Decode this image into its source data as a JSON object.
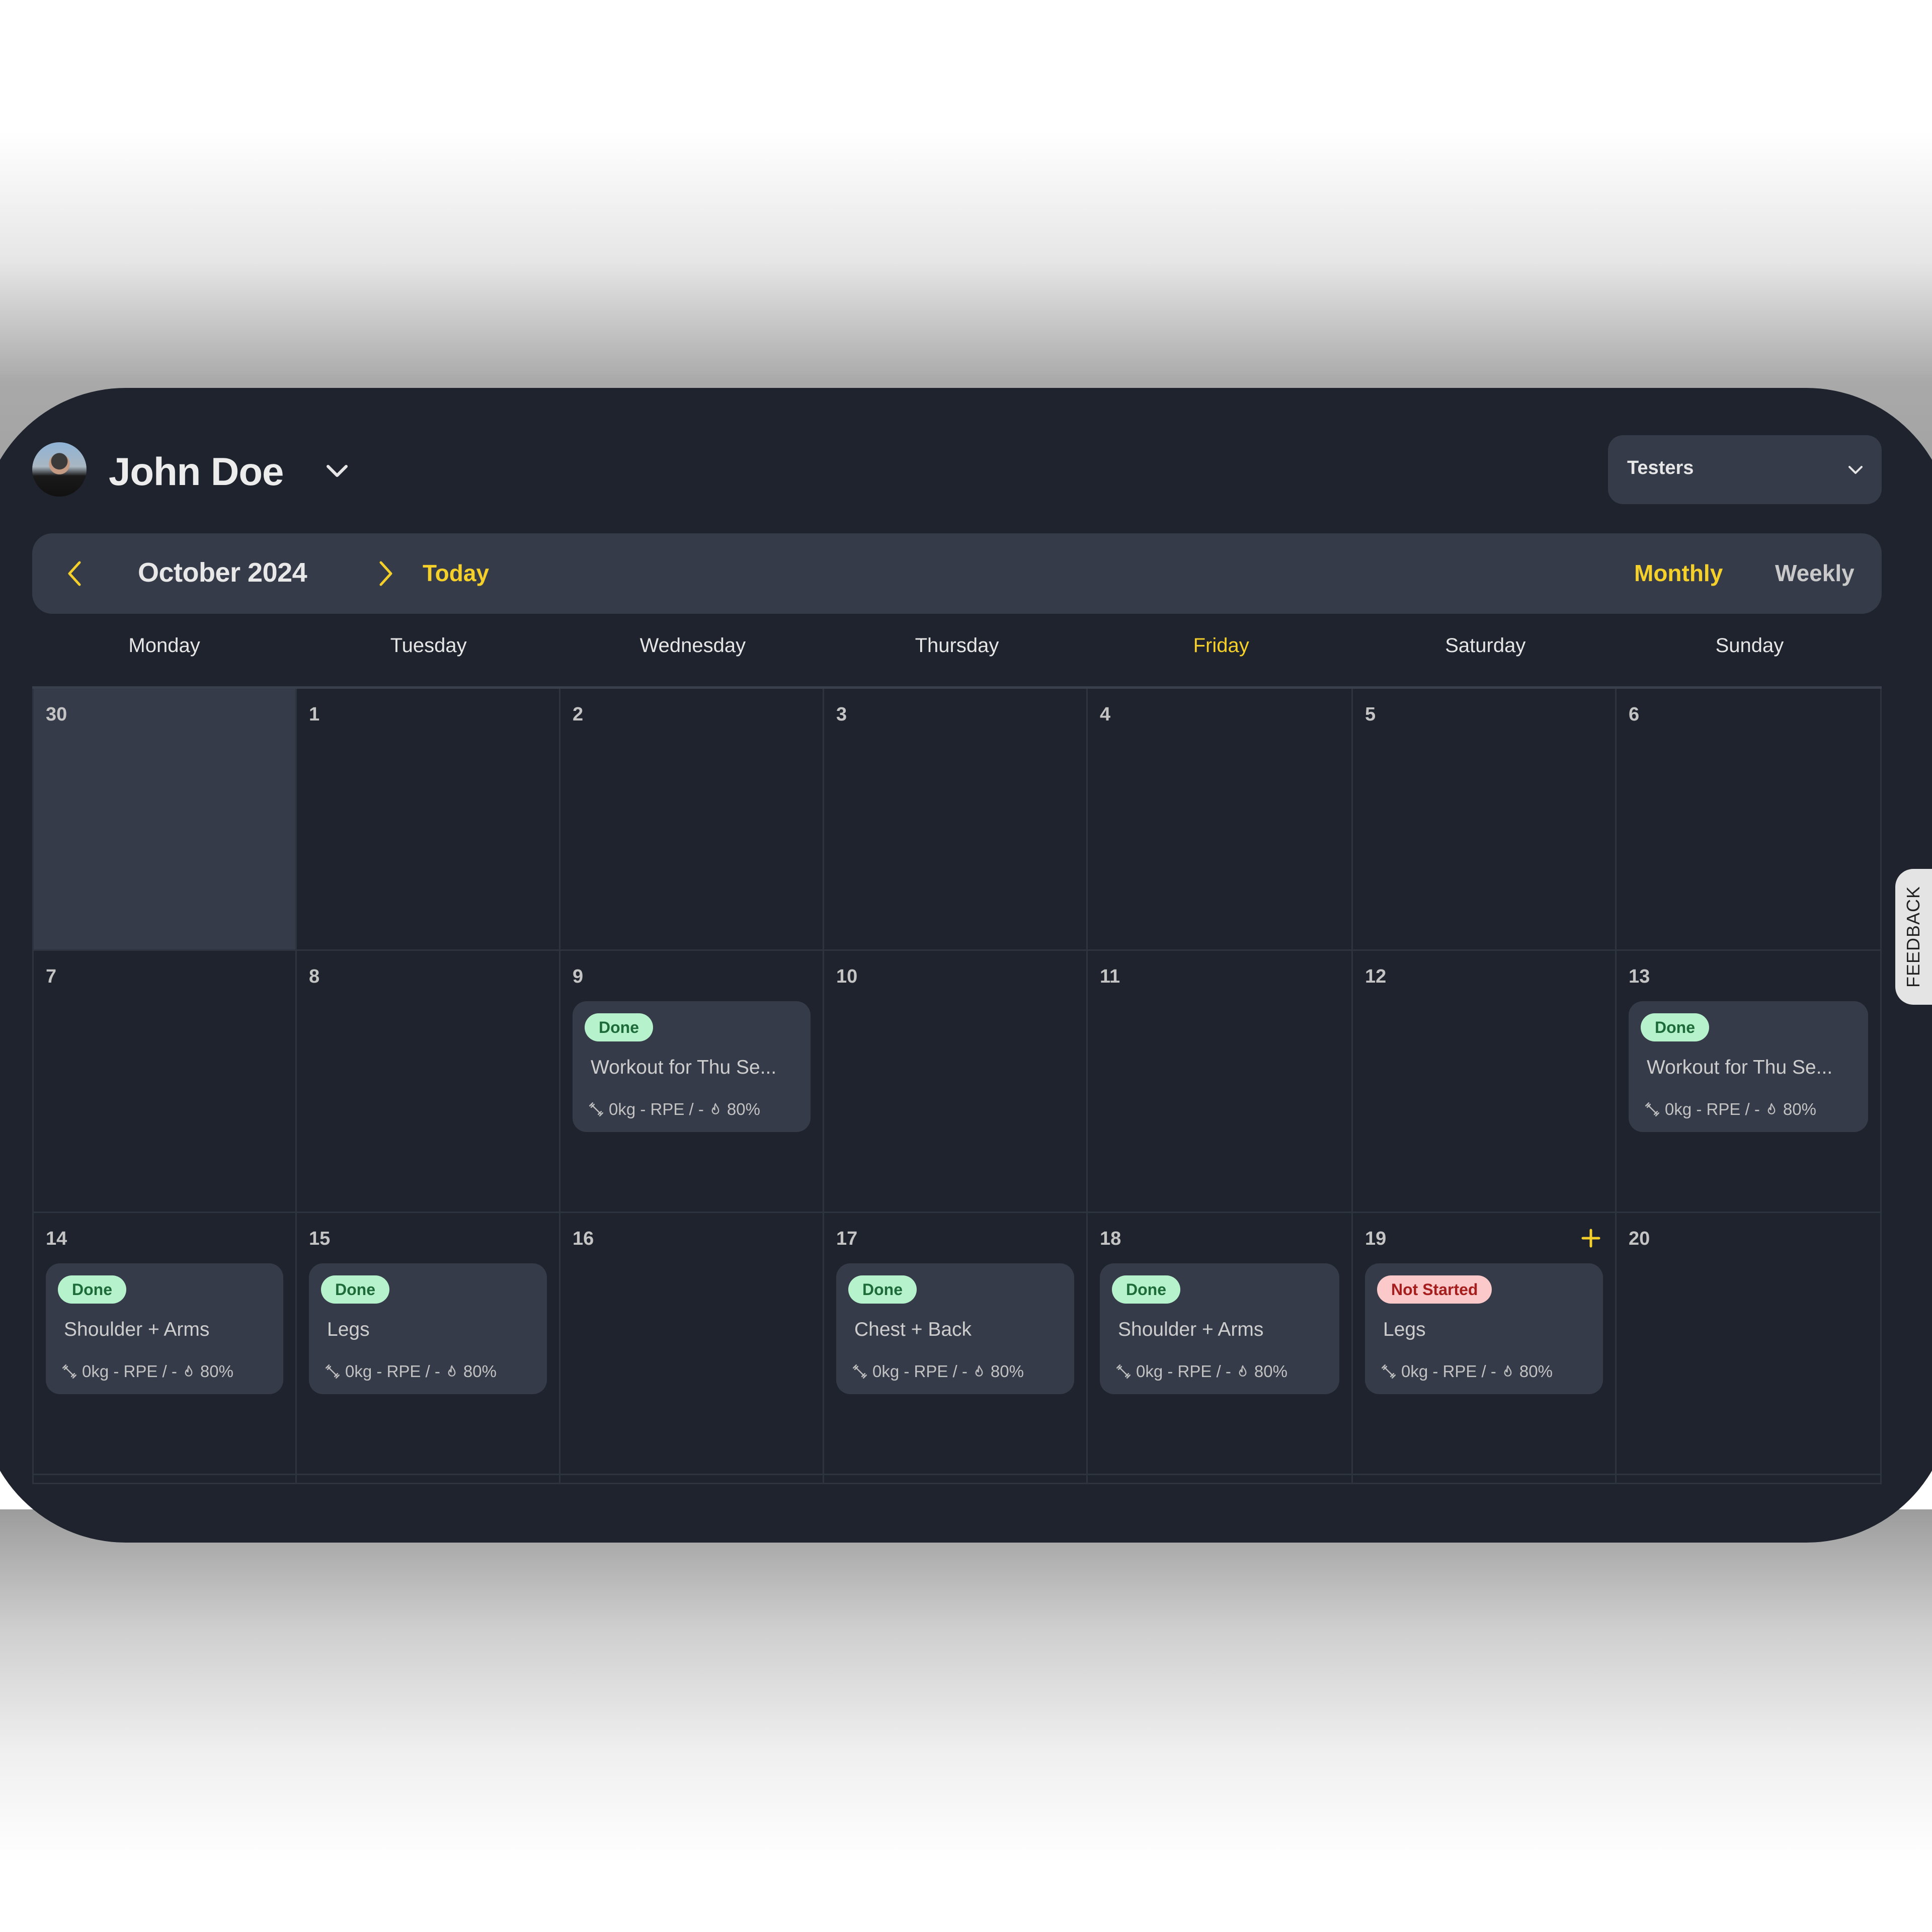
{
  "user": {
    "name": "John Doe",
    "avatar_icon": "user-photo-avatar"
  },
  "group_select": {
    "value": "Testers"
  },
  "nav": {
    "month_label": "October 2024",
    "today_label": "Today",
    "prev_icon": "chevron-left-icon",
    "next_icon": "chevron-right-icon",
    "views": [
      {
        "label": "Monthly",
        "active": true
      },
      {
        "label": "Weekly",
        "active": false
      }
    ]
  },
  "colors": {
    "accent": "#f5d02a",
    "panel_bg": "#1f232d",
    "surface": "#363b4a",
    "done_bg": "#b6f2cc",
    "done_text": "#1d6b38",
    "not_started_bg": "#fbc9c9",
    "not_started_text": "#a51d1d"
  },
  "weekdays": [
    "Monday",
    "Tuesday",
    "Wednesday",
    "Thursday",
    "Friday",
    "Saturday",
    "Sunday"
  ],
  "today_weekday_index": 4,
  "weeks": [
    [
      {
        "date": "30",
        "outside": true
      },
      {
        "date": "1"
      },
      {
        "date": "2"
      },
      {
        "date": "3"
      },
      {
        "date": "4"
      },
      {
        "date": "5"
      },
      {
        "date": "6"
      }
    ],
    [
      {
        "date": "7"
      },
      {
        "date": "8"
      },
      {
        "date": "9",
        "workout": {
          "status": "Done",
          "status_key": "done",
          "title": "Workout for Thu Se...",
          "meta_weight": "0kg - RPE / -",
          "meta_progress": "80%"
        }
      },
      {
        "date": "10"
      },
      {
        "date": "11"
      },
      {
        "date": "12"
      },
      {
        "date": "13",
        "workout": {
          "status": "Done",
          "status_key": "done",
          "title": "Workout for Thu Se...",
          "meta_weight": "0kg - RPE / -",
          "meta_progress": "80%"
        }
      }
    ],
    [
      {
        "date": "14",
        "workout": {
          "status": "Done",
          "status_key": "done",
          "title": "Shoulder + Arms",
          "meta_weight": "0kg - RPE / -",
          "meta_progress": "80%"
        }
      },
      {
        "date": "15",
        "workout": {
          "status": "Done",
          "status_key": "done",
          "title": "Legs",
          "meta_weight": "0kg - RPE / -",
          "meta_progress": "80%"
        }
      },
      {
        "date": "16"
      },
      {
        "date": "17",
        "workout": {
          "status": "Done",
          "status_key": "done",
          "title": "Chest + Back",
          "meta_weight": "0kg - RPE / -",
          "meta_progress": "80%"
        }
      },
      {
        "date": "18",
        "workout": {
          "status": "Done",
          "status_key": "done",
          "title": "Shoulder + Arms",
          "meta_weight": "0kg - RPE / -",
          "meta_progress": "80%"
        }
      },
      {
        "date": "19",
        "add_button": true,
        "workout": {
          "status": "Not Started",
          "status_key": "not-started",
          "title": "Legs",
          "meta_weight": "0kg - RPE / -",
          "meta_progress": "80%"
        }
      },
      {
        "date": "20"
      }
    ]
  ],
  "feedback_label": "FEEDBACK",
  "help_label": "?"
}
